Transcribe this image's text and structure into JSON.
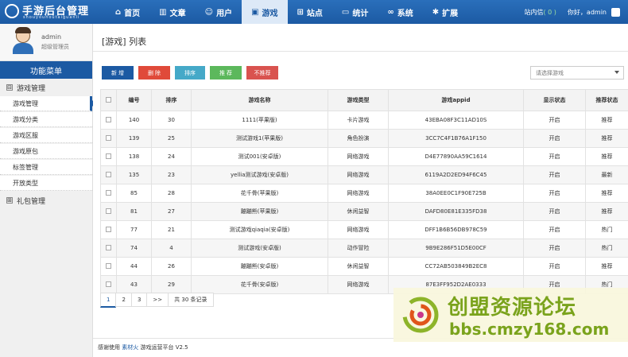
{
  "app": {
    "logo_title": "手游后台管理",
    "logo_sub": "shouyouhoutaiguanli"
  },
  "nav": [
    {
      "label": "首页",
      "icon": "home-icon"
    },
    {
      "label": "文章",
      "icon": "bar-chart-icon"
    },
    {
      "label": "用户",
      "icon": "user-icon"
    },
    {
      "label": "游戏",
      "icon": "monitor-icon",
      "active": true
    },
    {
      "label": "站点",
      "icon": "sitemap-icon"
    },
    {
      "label": "统计",
      "icon": "desktop-icon"
    },
    {
      "label": "系统",
      "icon": "link-icon"
    },
    {
      "label": "扩展",
      "icon": "gear-icon"
    }
  ],
  "topright": {
    "msg_label": "站内信",
    "msg_count": "( 0 )",
    "greeting": "你好，admin"
  },
  "profile": {
    "name": "admin",
    "role": "超级管理员"
  },
  "sidebar": {
    "header": "功能菜单",
    "group1": "游戏管理",
    "group1_sym": "⊟",
    "items": [
      "游戏管理",
      "游戏分类",
      "游戏区服",
      "游戏原包",
      "标签管理",
      "开放类型"
    ],
    "group2": "礼包管理",
    "group2_sym": "⊞"
  },
  "page": {
    "title": "[游戏] 列表"
  },
  "toolbar": {
    "add": "新 增",
    "delete": "删 除",
    "sort": "排序",
    "recommend": "推 荐",
    "unrecommend": "不推荐",
    "filter_placeholder": "请选择游戏"
  },
  "colors": {
    "add": "#1c5aa3",
    "delete": "#e04a3a",
    "sort": "#45a9c8",
    "recommend": "#5cb85c",
    "unrecommend": "#d9534f"
  },
  "table": {
    "headers": [
      "编号",
      "排序",
      "游戏名称",
      "游戏类型",
      "游戏appid",
      "显示状态",
      "推荐状态"
    ],
    "rows": [
      [
        "140",
        "30",
        "1111(苹果版)",
        "卡片游戏",
        "43EBA08F3C11AD10S",
        "开启",
        "推荐"
      ],
      [
        "139",
        "25",
        "测试游戏1(苹果版)",
        "角色扮演",
        "3CC7C4F1B76A1F150",
        "开启",
        "推荐"
      ],
      [
        "138",
        "24",
        "测试001(安卓版)",
        "网络游戏",
        "D4E77890AA59C1614",
        "开启",
        "推荐"
      ],
      [
        "135",
        "23",
        "yellia测试游戏(安卓版)",
        "网络游戏",
        "6119A2D2ED94F6C45",
        "开启",
        "最新"
      ],
      [
        "85",
        "28",
        "花千骨(苹果版)",
        "网络游戏",
        "38A0EE0C1F90E725B",
        "开启",
        "推荐"
      ],
      [
        "81",
        "27",
        "蹦蹦熊(苹果版)",
        "休闲益智",
        "DAFD80E81E335FD38",
        "开启",
        "推荐"
      ],
      [
        "77",
        "21",
        "测试游戏qiaqia(安卓版)",
        "网络游戏",
        "DFF1B6B56DB978C59",
        "开启",
        "热门"
      ],
      [
        "74",
        "4",
        "测试游戏(安卓版)",
        "动作冒险",
        "9B9E286F51D5E00CF",
        "开启",
        "热门"
      ],
      [
        "44",
        "26",
        "蹦蹦熊(安卓版)",
        "休闲益智",
        "CC72AB503849B2EC8",
        "开启",
        "推荐"
      ],
      [
        "43",
        "29",
        "花千骨(安卓版)",
        "网络游戏",
        "87E3FF952D2AE0333",
        "开启",
        "热门"
      ]
    ]
  },
  "pager": {
    "pages": [
      "1",
      "2",
      "3"
    ],
    "next": ">>",
    "total": "共 30 条记录"
  },
  "footer": {
    "prefix": "感谢使用",
    "link": "素材火",
    "suffix": "游戏运营平台 V2.5"
  },
  "watermark": {
    "title": "创盟资源论坛",
    "url": "bbs.cmzy168.com"
  }
}
